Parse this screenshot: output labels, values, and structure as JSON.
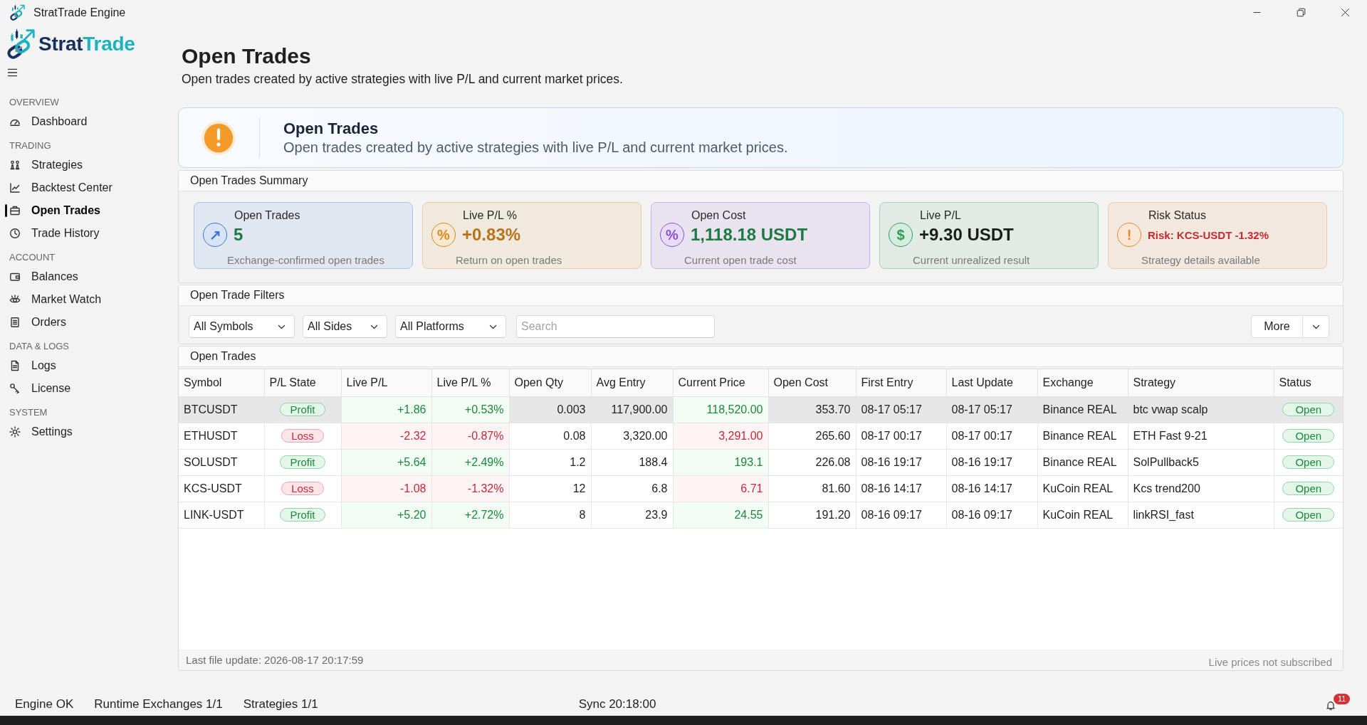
{
  "window": {
    "title": "StratTrade Engine"
  },
  "logo": {
    "wordmark": [
      "Strat",
      "Trade"
    ]
  },
  "sidebar": {
    "sections": [
      {
        "title": "OVERVIEW",
        "items": [
          {
            "label": "Dashboard",
            "selected": false
          }
        ]
      },
      {
        "title": "TRADING",
        "items": [
          {
            "label": "Strategies",
            "selected": false
          },
          {
            "label": "Backtest Center",
            "selected": false
          },
          {
            "label": "Open Trades",
            "selected": true
          },
          {
            "label": "Trade History",
            "selected": false
          }
        ]
      },
      {
        "title": "ACCOUNT",
        "items": [
          {
            "label": "Balances",
            "selected": false
          },
          {
            "label": "Market Watch",
            "selected": false
          },
          {
            "label": "Orders",
            "selected": false
          }
        ]
      },
      {
        "title": "DATA & LOGS",
        "items": [
          {
            "label": "Logs",
            "selected": false
          },
          {
            "label": "License",
            "selected": false
          }
        ]
      },
      {
        "title": "SYSTEM",
        "items": [
          {
            "label": "Settings",
            "selected": false
          }
        ]
      }
    ]
  },
  "page": {
    "title": "Open Trades",
    "subtitle": "Open trades created by active strategies with live P/L and current market prices."
  },
  "banner": {
    "title": "Open Trades",
    "text": "Open trades created by active strategies with live P/L and current market prices."
  },
  "summary": {
    "title": "Open Trades Summary",
    "cards": [
      {
        "label": "Open Trades",
        "glyph": "↗",
        "value": "5",
        "note": "Exchange-confirmed open trades",
        "color": "#3a78d0",
        "kind": "positive"
      },
      {
        "label": "Live P/L %",
        "glyph": "%",
        "value": "+0.83%",
        "note": "Return on open trades",
        "color": "#d98a1c",
        "kind": "warning"
      },
      {
        "label": "Open Cost",
        "glyph": "%",
        "value": "1,118.18 USDT",
        "note": "Current open trade cost",
        "color": "#8a4fd6",
        "kind": "positive"
      },
      {
        "label": "Live P/L",
        "glyph": "$",
        "value": "+9.30 USDT",
        "note": "Current unrealized result",
        "color": "#2e9e5b",
        "kind": "neutral"
      },
      {
        "label": "Risk Status",
        "glyph": "!",
        "value": "Risk: KCS-USDT -1.32%",
        "note": "Strategy details available",
        "color": "#e8892e",
        "kind": "danger"
      }
    ]
  },
  "filters": {
    "title": "Open Trade Filters",
    "dropdowns": [
      "All Symbols",
      "All Sides",
      "All Platforms"
    ],
    "search": {
      "placeholder": "Search"
    },
    "more_button": "More"
  },
  "table": {
    "title": "Open Trades",
    "columns": [
      "Symbol",
      "P/L State",
      "Live P/L",
      "Live P/L %",
      "Open Qty",
      "Avg Entry",
      "Current Price",
      "Open Cost",
      "First Entry",
      "Last Update",
      "Exchange",
      "Strategy",
      "Status"
    ],
    "rows": [
      {
        "selected": true,
        "kind": "profit",
        "cells": [
          "BTCUSDT",
          "Profit",
          "+1.86",
          "+0.53%",
          "0.003",
          "117,900.00",
          "118,520.00",
          "353.70",
          "08-17 05:17",
          "08-17 05:17",
          "Binance REAL",
          "btc vwap scalp",
          "Open"
        ]
      },
      {
        "selected": false,
        "kind": "loss",
        "cells": [
          "ETHUSDT",
          "Loss",
          "-2.32",
          "-0.87%",
          "0.08",
          "3,320.00",
          "3,291.00",
          "265.60",
          "08-17 00:17",
          "08-17 00:17",
          "Binance REAL",
          "ETH Fast 9-21",
          "Open"
        ]
      },
      {
        "selected": false,
        "kind": "profit",
        "cells": [
          "SOLUSDT",
          "Profit",
          "+5.64",
          "+2.49%",
          "1.2",
          "188.4",
          "193.1",
          "226.08",
          "08-16 19:17",
          "08-16 19:17",
          "Binance REAL",
          "SolPullback5",
          "Open"
        ]
      },
      {
        "selected": false,
        "kind": "loss",
        "cells": [
          "KCS-USDT",
          "Loss",
          "-1.08",
          "-1.32%",
          "12",
          "6.8",
          "6.71",
          "81.60",
          "08-16 14:17",
          "08-16 14:17",
          "KuCoin REAL",
          "Kcs trend200",
          "Open"
        ]
      },
      {
        "selected": false,
        "kind": "profit",
        "cells": [
          "LINK-USDT",
          "Profit",
          "+5.20",
          "+2.72%",
          "8",
          "23.9",
          "24.55",
          "191.20",
          "08-16 09:17",
          "08-16 09:17",
          "KuCoin REAL",
          "linkRSI_fast",
          "Open"
        ]
      }
    ],
    "footer_left": "Last file update: 2026-08-17 20:17:59",
    "footer_right": "Live prices not subscribed"
  },
  "status_bar": {
    "items": [
      "Engine OK",
      "Runtime Exchanges 1/1",
      "Strategies 1/1"
    ],
    "sync": "Sync 20:18:00",
    "notifications": "11"
  }
}
